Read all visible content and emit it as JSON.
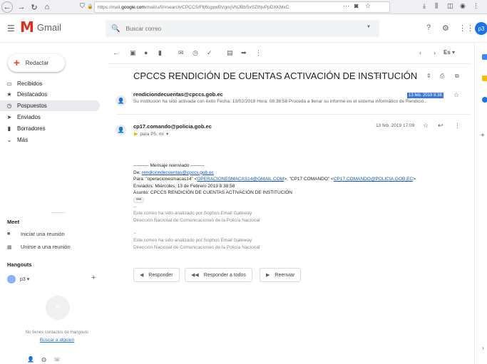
{
  "browser": {
    "url_prefix": "https://mail.",
    "url_host": "google.com",
    "url_rest": "/mail/u/0/#search/CPCCS/FMfcgxwBVgmjVNJBbSvSZtNvPpDXKMxC",
    "more_dots": "···"
  },
  "header": {
    "app_name": "Gmail",
    "search_placeholder": "Buscar correo",
    "avatar_label": "p3"
  },
  "sidebar": {
    "compose_label": "Redactar",
    "items": [
      {
        "label": "Recibidos",
        "icon": "inbox-icon"
      },
      {
        "label": "Destacados",
        "icon": "star-icon"
      },
      {
        "label": "Pospuestos",
        "icon": "clock-icon"
      },
      {
        "label": "Enviados",
        "icon": "send-icon"
      },
      {
        "label": "Borradores",
        "icon": "draft-icon"
      },
      {
        "label": "Más",
        "icon": "chevron-down-icon"
      }
    ],
    "meet_title": "Meet",
    "meet_new": "Iniciar una reunión",
    "meet_join": "Unirse a una reunión",
    "hangouts_title": "Hangouts",
    "hangouts_user": "p3",
    "hangouts_user_caret": "▾",
    "hangouts_empty": "No tienes contactos de Hangouts",
    "hangouts_link": "Buscar a alguien"
  },
  "toolbar": {
    "lang": "Es"
  },
  "thread": {
    "subject": "CPCCS RENDICIÓN DE CUENTAS ACTIVACIÓN DE INSTITUCIÓN",
    "messages": [
      {
        "sender": "rendiciondecuentas@cpccs.gob.ec",
        "snippet": "Su institución ha sido activada con éxito Fecha: 13/02/2019 Hora: 08:38:58 Proceda a llenar su informe en el sistema informático de Rendició...",
        "date": "13 feb. 2019 8:38"
      },
      {
        "sender": "cp17.comando@policia.gob.ec",
        "to": "para P5, mí",
        "date": "13 feb. 2019 17:09"
      }
    ],
    "body": {
      "fwd_header": "---------- Mensaje reenviado ---------",
      "from_label": "De: ",
      "from_link": "rendiciondecuentas@cpccs.gob.ec",
      "to_label": "Para: \"operacionesmacas14\" <",
      "to_link1": "OPERACIONESMACAS14@GMAIL.COM",
      "to_mid": ">, \"CP17 COMANDO\" <",
      "to_link2": "CP17.COMANDO@POLICIA.GOB.EC",
      "to_end": ">",
      "sent": "Enviados: Miércoles, 13 de Febrero 2019 8:38:58",
      "subject_line": "Asunto: CPCCS RENDICIÓN DE CUENTAS ACTIVACIÓN DE INSTITUCIÓN",
      "dots": "•••",
      "dash1": "--",
      "scan1": "Este correo ha sido analizado por Sophos Email Gateway",
      "dir1": "Dirección Nacional de Comunicaciones de la Policía Nacional",
      "dash2": "--",
      "scan2": "Este correo ha sido analizado por Sophos Email Gateway",
      "dir2": "Dirección Nacional de Comunicaciones de la Policía Nacional"
    },
    "actions": {
      "reply": "Responder",
      "reply_all": "Responder a todos",
      "forward": "Reenviar"
    }
  },
  "colors": {
    "gmail_red": "#d93025",
    "link_blue": "#1155cc",
    "highlight_blue": "#3c78d8"
  }
}
